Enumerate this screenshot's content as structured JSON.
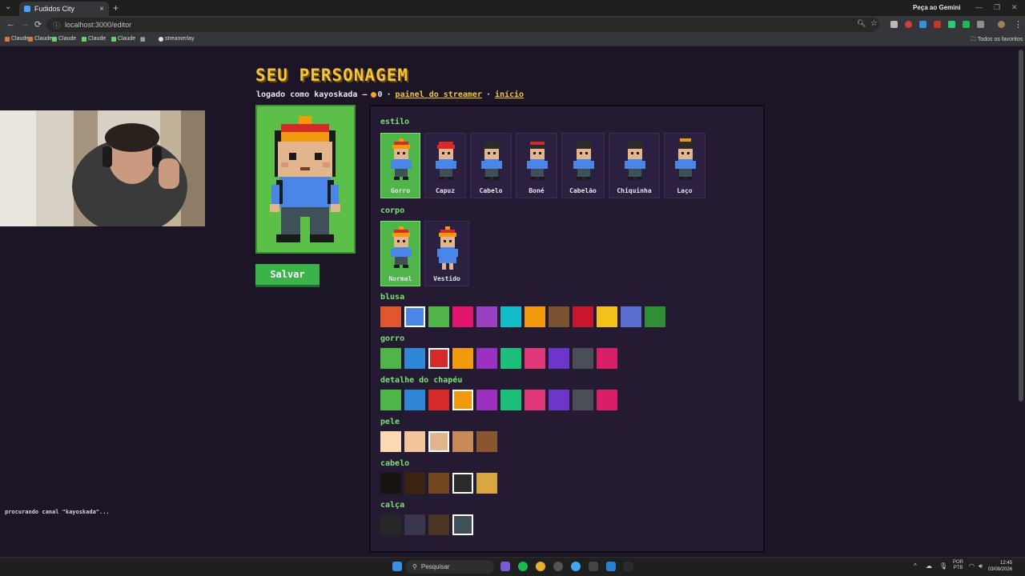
{
  "browser": {
    "tab_title": "Fudidos City",
    "new_tab": "+",
    "close": "×",
    "url": "localhost:3000/editor",
    "gemini": "Peça ao Gemini",
    "bookmarks": [
      "Claude",
      "Claude",
      "Claude",
      "Claude",
      "Claude",
      "streamerlay"
    ],
    "all_bookmarks": "Todos os favoritos"
  },
  "header": {
    "title": "SEU PERSONAGEM",
    "logged_as": "logado como kayoskada —",
    "coins": "0",
    "separator": "·",
    "link_streamer": "painel do streamer",
    "link_home": "início"
  },
  "save_label": "Salvar",
  "sections": {
    "estilo": "estilo",
    "corpo": "corpo",
    "blusa": "blusa",
    "gorro": "gorro",
    "detalhe": "detalhe do chapéu",
    "pele": "pele",
    "cabelo": "cabelo",
    "calca": "calça"
  },
  "styles": [
    {
      "label": "Gorro",
      "selected": true
    },
    {
      "label": "Capuz",
      "selected": false
    },
    {
      "label": "Cabelo",
      "selected": false
    },
    {
      "label": "Boné",
      "selected": false
    },
    {
      "label": "Cabelão",
      "selected": false
    },
    {
      "label": "Chiquinha",
      "selected": false
    },
    {
      "label": "Laço",
      "selected": false
    }
  ],
  "bodies": [
    {
      "label": "Normal",
      "selected": true
    },
    {
      "label": "Vestido",
      "selected": false
    }
  ],
  "palettes": {
    "blusa": {
      "colors": [
        "#e0562e",
        "#4a86e8",
        "#4fb548",
        "#e0156b",
        "#9a3fc0",
        "#12bcc9",
        "#f29a0c",
        "#7a5230",
        "#c8172f",
        "#f2c21b",
        "#5b6fd1",
        "#2f8f36"
      ],
      "selected": 1
    },
    "gorro": {
      "colors": [
        "#4fb548",
        "#2f86d6",
        "#d62a2a",
        "#f29a0c",
        "#9a2fc0",
        "#1cbf7a",
        "#e0397a",
        "#6b36c9",
        "#4b4f57",
        "#d91f66"
      ],
      "selected": 2
    },
    "detalhe": {
      "colors": [
        "#4fb548",
        "#2f86d6",
        "#d62a2a",
        "#f29a0c",
        "#9a2fc0",
        "#1cbf7a",
        "#e0397a",
        "#6b36c9",
        "#4b4f57",
        "#d91f66"
      ],
      "selected": 3
    },
    "pele": {
      "colors": [
        "#fbd9b5",
        "#f2c49b",
        "#e3b58c",
        "#c98a5a",
        "#8a5630"
      ],
      "selected": 2
    },
    "cabelo": {
      "colors": [
        "#171310",
        "#3b2412",
        "#73481f",
        "#2a2a2a",
        "#d9a642"
      ],
      "selected": 3
    },
    "calca": {
      "colors": [
        "#262626",
        "#3a3650",
        "#4a3424",
        "#3f5058"
      ],
      "selected": 3
    }
  },
  "status_log": "procurando canal \"kayoskada\"...",
  "taskbar": {
    "search": "Pesquisar",
    "lang": "POR",
    "lang2": "PTB",
    "time": "12:45",
    "date": "03/08/2026"
  }
}
